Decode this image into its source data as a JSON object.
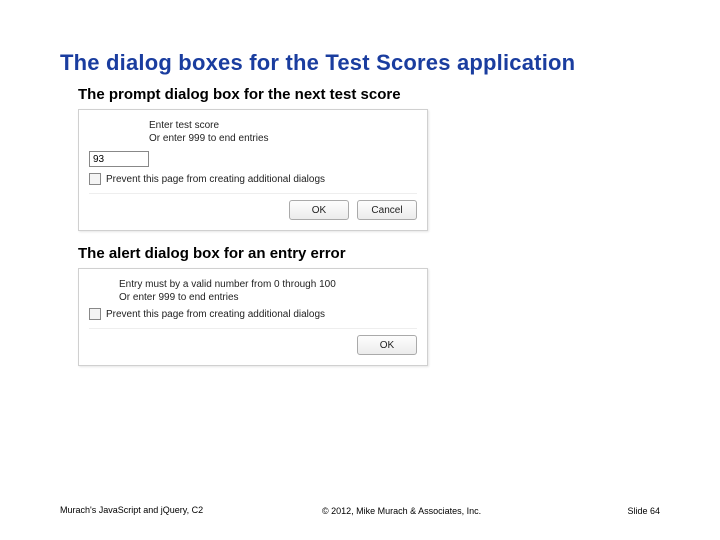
{
  "title": "The dialog boxes for the Test Scores application",
  "sub1": "The prompt dialog box for the next test score",
  "prompt": {
    "line1": "Enter test score",
    "line2": "Or enter 999 to end entries",
    "input_value": "93",
    "prevent_label": "Prevent this page from creating additional dialogs",
    "ok": "OK",
    "cancel": "Cancel"
  },
  "sub2": "The alert dialog box for an entry error",
  "alert": {
    "line1": "Entry must by a valid number from 0 through 100",
    "line2": "Or enter 999 to end entries",
    "prevent_label": "Prevent this page from creating additional dialogs",
    "ok": "OK"
  },
  "footer": {
    "left": "Murach's JavaScript and jQuery, C2",
    "center": "© 2012, Mike Murach & Associates, Inc.",
    "right": "Slide 64"
  }
}
